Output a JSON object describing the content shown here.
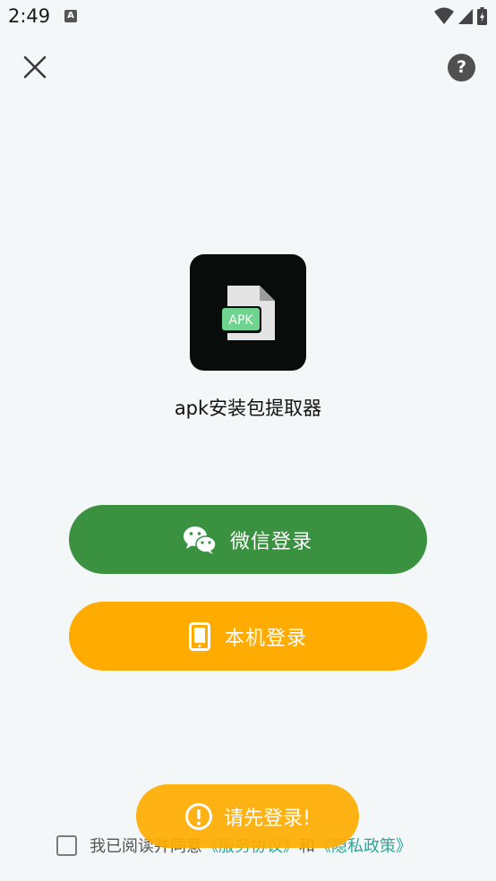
{
  "status_bar": {
    "time": "2:49",
    "notif_icon": "A"
  },
  "header": {
    "close_icon": "close-icon",
    "help_label": "?"
  },
  "app": {
    "name": "apk安装包提取器",
    "icon_badge": "APK"
  },
  "login": {
    "wechat_label": "微信登录",
    "local_label": "本机登录"
  },
  "agreement": {
    "prefix": "我已阅读并同意",
    "service_link": "《服务协议》",
    "and": "和",
    "privacy_link": "《隐私政策》"
  },
  "toast": {
    "message": "请先登录!"
  },
  "colors": {
    "wechat": "#3a9140",
    "local": "#ffab00",
    "link": "#2aa898",
    "background": "#f3f7f8"
  }
}
